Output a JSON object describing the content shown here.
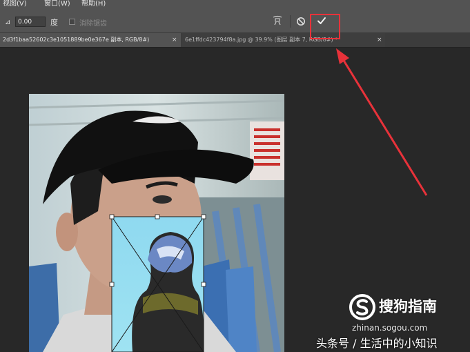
{
  "menu": {
    "items": [
      {
        "label": "视图(V)"
      },
      {
        "label": "窗口(W)"
      },
      {
        "label": "帮助(H)"
      }
    ]
  },
  "options": {
    "angle_value": "0.00",
    "angle_unit": "度",
    "antialias_label": "消除锯齿",
    "antialias_checked": false,
    "icons": [
      "angle-icon",
      "warp-icon",
      "cancel-icon",
      "commit-checkmark-icon"
    ]
  },
  "tabs": [
    {
      "title": "2d3f1baa52602c3e1051889be0e367e 副本, RGB/8#)",
      "close": "×",
      "active": true
    },
    {
      "title": "6e1ffdc423794f8a.jpg @ 39.9% (图层 副本 7, RGB/8#) *",
      "close": "×",
      "active": false
    }
  ],
  "annotation": {
    "color": "#e8323a"
  },
  "watermark": {
    "brand": "搜狗指南",
    "url": "zhinan.sogou.com",
    "credit": "头条号 / 生活中的小知识"
  }
}
